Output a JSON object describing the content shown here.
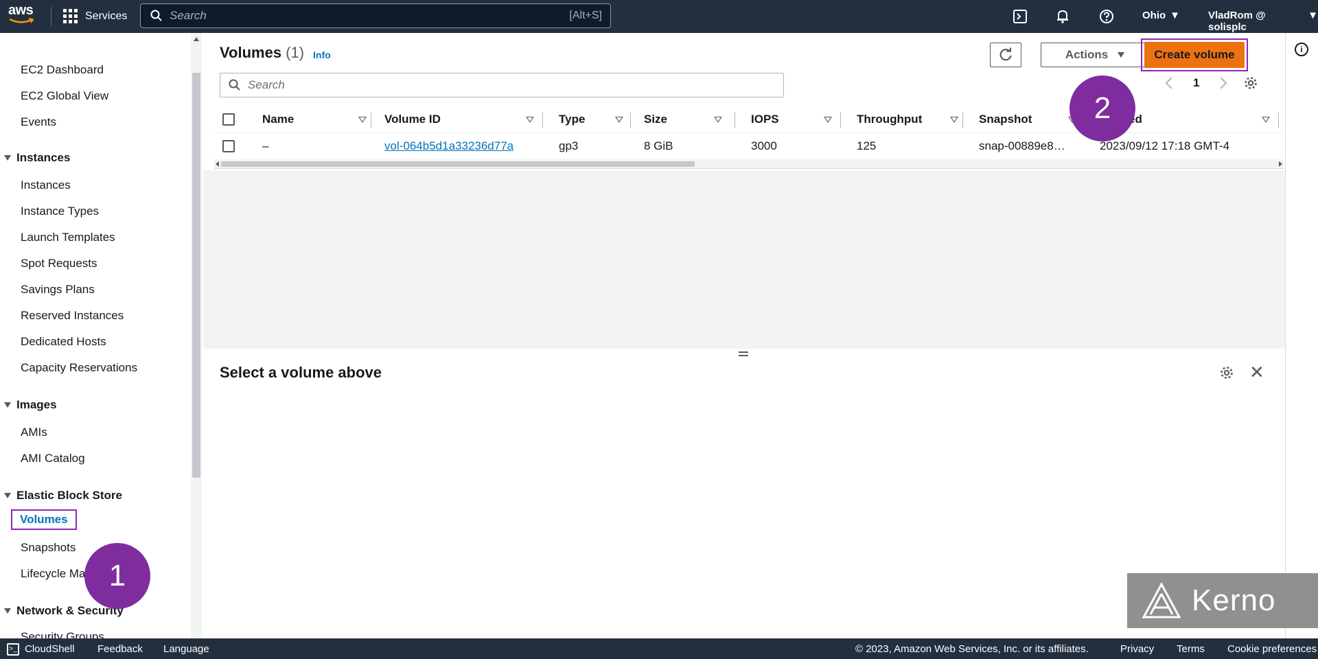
{
  "topnav": {
    "logo": "aws",
    "services_label": "Services",
    "search_placeholder": "Search",
    "search_shortcut": "[Alt+S]",
    "region": "Ohio",
    "account": "VladRom @ solisplc"
  },
  "sidebar": {
    "top_links": [
      "EC2 Dashboard",
      "EC2 Global View",
      "Events"
    ],
    "sections": [
      {
        "title": "Instances",
        "items": [
          "Instances",
          "Instance Types",
          "Launch Templates",
          "Spot Requests",
          "Savings Plans",
          "Reserved Instances",
          "Dedicated Hosts",
          "Capacity Reservations"
        ]
      },
      {
        "title": "Images",
        "items": [
          "AMIs",
          "AMI Catalog"
        ]
      },
      {
        "title": "Elastic Block Store",
        "items": [
          "Volumes",
          "Snapshots",
          "Lifecycle Ma"
        ]
      },
      {
        "title": "Network & Security",
        "items": [
          "Security Groups"
        ]
      }
    ],
    "active_item": "Volumes"
  },
  "volumes": {
    "title": "Volumes",
    "count": "(1)",
    "info_label": "Info",
    "actions_label": "Actions",
    "create_label": "Create volume",
    "search_placeholder": "Search",
    "page_number": "1",
    "columns": [
      "Name",
      "Volume ID",
      "Type",
      "Size",
      "IOPS",
      "Throughput",
      "Snapshot",
      "ed"
    ],
    "rows": [
      {
        "name": "–",
        "volume_id": "vol-064b5d1a33236d77a",
        "type": "gp3",
        "size": "8 GiB",
        "iops": "3000",
        "throughput": "125",
        "snapshot": "snap-00889e8…",
        "created": "2023/09/12 17:18 GMT-4"
      }
    ]
  },
  "details": {
    "title": "Select a volume above"
  },
  "badges": {
    "step1": "1",
    "step2": "2"
  },
  "watermark": "Kerno",
  "footer": {
    "cloudshell": "CloudShell",
    "feedback": "Feedback",
    "language": "Language",
    "copyright": "© 2023, Amazon Web Services, Inc. or its affiliates.",
    "privacy": "Privacy",
    "terms": "Terms",
    "cookies": "Cookie preferences"
  },
  "colors": {
    "nav_bg": "#232f3e",
    "accent_orange": "#ec7211",
    "link_blue": "#0073bb",
    "highlight_purple": "#8c27b5",
    "badge_purple": "#7f2d9e"
  }
}
